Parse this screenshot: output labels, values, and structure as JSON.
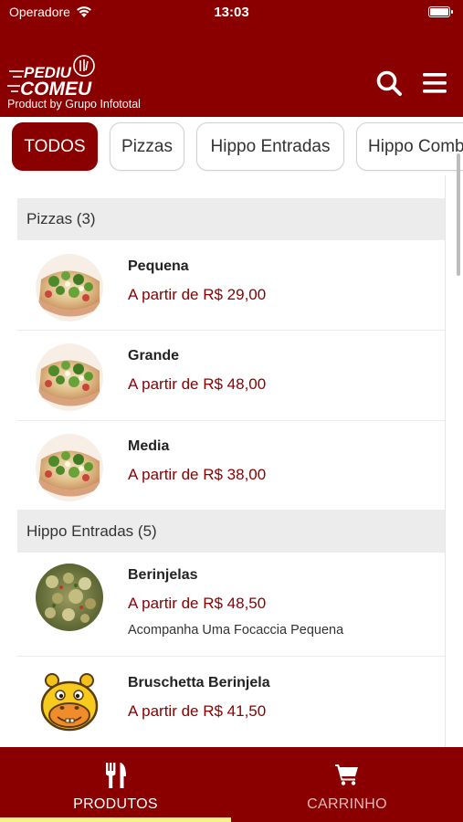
{
  "status_bar": {
    "carrier": "Operadore",
    "time": "13:03"
  },
  "header": {
    "logo_text_top": "PEDIU",
    "logo_text_bottom": "COMEU",
    "logo_caption": "Product by Grupo Infototal"
  },
  "tabs": [
    {
      "label": "TODOS",
      "active": true
    },
    {
      "label": "Pizzas",
      "active": false
    },
    {
      "label": "Hippo Entradas",
      "active": false
    },
    {
      "label": "Hippo Combos",
      "active": false
    }
  ],
  "sections": [
    {
      "title": "Pizzas (3)",
      "items": [
        {
          "name": "Pequena",
          "price": "A partir de R$ 29,00",
          "image": "pizza-image"
        },
        {
          "name": "Grande",
          "price": "A partir de R$ 48,00",
          "image": "pizza-image"
        },
        {
          "name": "Media",
          "price": "A partir de R$ 38,00",
          "image": "pizza-image"
        }
      ]
    },
    {
      "title": "Hippo Entradas (5)",
      "items": [
        {
          "name": "Berinjelas",
          "price": "A partir de R$ 48,50",
          "description": "Acompanha Uma Focaccia Pequena",
          "image": "eggplant-image"
        },
        {
          "name": "Bruschetta Berinjela",
          "price": "A partir de R$ 41,50",
          "image": "hippo-mascot-image"
        }
      ]
    }
  ],
  "bottom_nav": [
    {
      "label": "PRODUTOS",
      "icon": "fork-knife-icon",
      "active": true
    },
    {
      "label": "CARRINHO",
      "icon": "cart-icon",
      "active": false
    }
  ],
  "colors": {
    "brand": "#8a0000",
    "active_indicator": "#f6f28a",
    "section_bg": "#ececec"
  }
}
